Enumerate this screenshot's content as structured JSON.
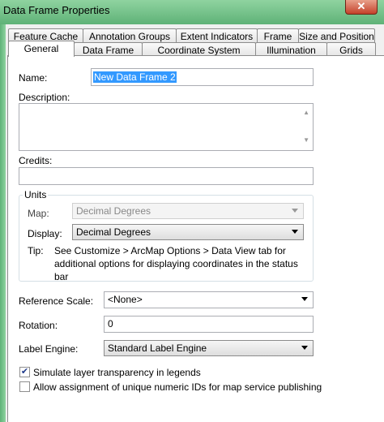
{
  "window": {
    "title": "Data Frame Properties",
    "close_label": "✕"
  },
  "tabs_row1": [
    "Feature Cache",
    "Annotation Groups",
    "Extent Indicators",
    "Frame",
    "Size and Position"
  ],
  "tabs_row2": [
    "General",
    "Data Frame",
    "Coordinate System",
    "Illumination",
    "Grids"
  ],
  "active_tab": "General",
  "general": {
    "name_label": "Name:",
    "name_value": "New Data Frame 2",
    "description_label": "Description:",
    "description_value": "",
    "credits_label": "Credits:",
    "credits_value": "",
    "units": {
      "title": "Units",
      "map_label": "Map:",
      "map_value": "Decimal Degrees",
      "display_label": "Display:",
      "display_value": "Decimal Degrees",
      "tip_label": "Tip:",
      "tip_text": "See Customize > ArcMap Options > Data View tab for additional options for displaying coordinates in the status bar"
    },
    "reference_scale_label": "Reference Scale:",
    "reference_scale_value": "<None>",
    "rotation_label": "Rotation:",
    "rotation_value": "0",
    "label_engine_label": "Label Engine:",
    "label_engine_value": "Standard Label Engine",
    "simulate_transparency_label": "Simulate layer transparency in legends",
    "simulate_transparency_checked": true,
    "unique_ids_label": "Allow assignment of unique numeric IDs for map service publishing",
    "unique_ids_checked": false
  }
}
